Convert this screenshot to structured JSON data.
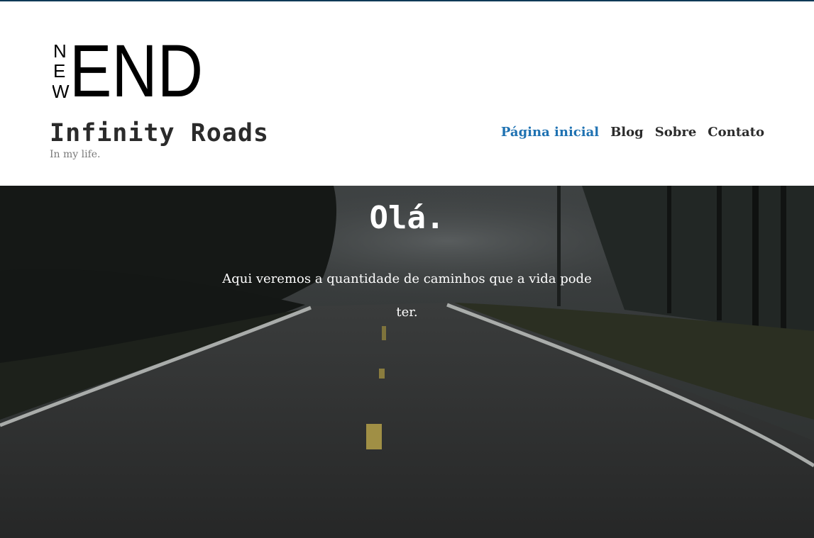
{
  "header": {
    "logo": {
      "small_letters": [
        "N",
        "E",
        "W"
      ],
      "big_text": "END"
    },
    "site_title": "Infinity Roads",
    "tagline": "In my life.",
    "nav": [
      {
        "label": "Página inicial",
        "active": true
      },
      {
        "label": "Blog",
        "active": false
      },
      {
        "label": "Sobre",
        "active": false
      },
      {
        "label": "Contato",
        "active": false
      }
    ]
  },
  "hero": {
    "heading": "Olá.",
    "text": "Aqui veremos a quantidade de caminhos que a vida pode ter.",
    "background": "foggy-road-photo"
  },
  "colors": {
    "accent": "#1f72b2",
    "text_dark": "#2b2b2b",
    "tagline": "#7a7a7a",
    "top_rule": "#0f3a56",
    "hero_text": "#ffffff"
  }
}
